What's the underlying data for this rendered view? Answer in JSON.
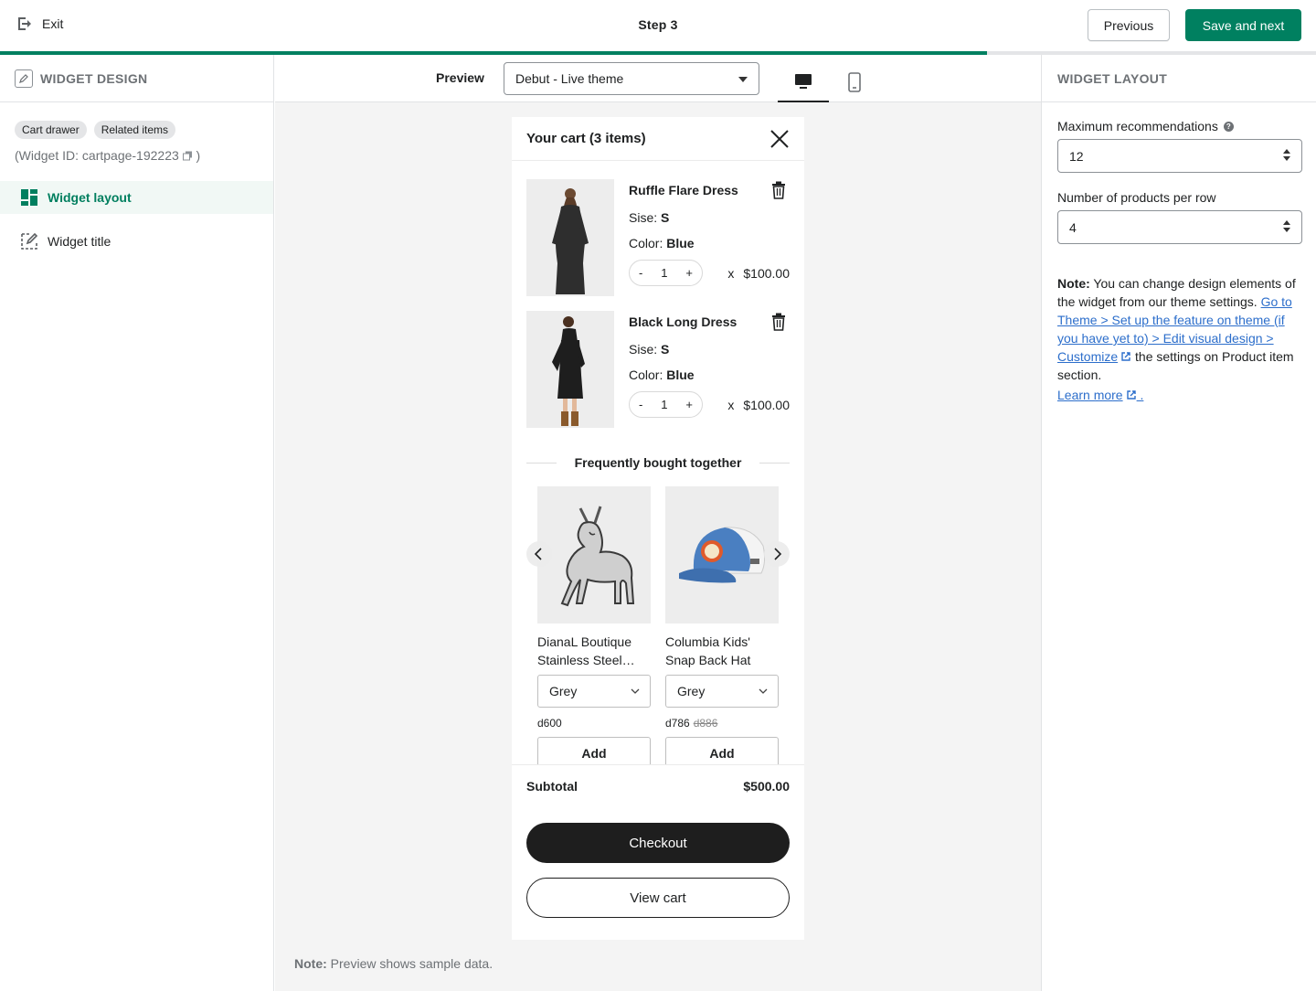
{
  "topbar": {
    "exit_label": "Exit",
    "step_label": "Step 3",
    "previous_label": "Previous",
    "save_next_label": "Save and next",
    "progress_fraction": 0.75
  },
  "left_panel": {
    "title": "WIDGET DESIGN",
    "tags": [
      "Cart drawer",
      "Related items"
    ],
    "widget_id_text": "(Widget ID: cartpage-192223",
    "widget_id_close": ")",
    "menu": [
      {
        "label": "Widget layout",
        "icon": "layout-icon",
        "active": true
      },
      {
        "label": "Widget title",
        "icon": "title-edit-icon",
        "active": false
      }
    ]
  },
  "preview": {
    "label": "Preview",
    "theme_selected": "Debut - Live theme",
    "devices": [
      "desktop-icon",
      "mobile-icon"
    ],
    "active_device": "desktop",
    "note_bold": "Note:",
    "note_text": " Preview shows sample data."
  },
  "cart": {
    "title": "Your cart (3 items)",
    "items": [
      {
        "name": "Ruffle Flare Dress",
        "size_label": "Sise: ",
        "size": "S",
        "color_label": "Color: ",
        "color": "Blue",
        "qty": "1",
        "x": "x",
        "price": "$100.00"
      },
      {
        "name": "Black Long Dress",
        "size_label": "Sise: ",
        "size": "S",
        "color_label": "Color: ",
        "color": "Blue",
        "qty": "1",
        "x": "x",
        "price": "$100.00"
      }
    ],
    "qty_minus": "-",
    "qty_plus": "+",
    "fbt_title": "Frequently bought together",
    "recommendations": [
      {
        "name": "DianaL Boutique Stainless Steel Silver Horse Pendant",
        "variant": "Grey",
        "price": "d600",
        "compare_price": "",
        "add_label": "Add"
      },
      {
        "name": "Columbia Kids' Snap Back Hat",
        "variant": "Grey",
        "price": "d786",
        "compare_price": "d886",
        "add_label": "Add"
      }
    ],
    "subtotal_label": "Subtotal",
    "subtotal_value": "$500.00",
    "checkout_label": "Checkout",
    "view_cart_label": "View cart"
  },
  "right_panel": {
    "title": "WIDGET LAYOUT",
    "max_rec_label": "Maximum recommendations",
    "max_rec_value": "12",
    "per_row_label": "Number of products per row",
    "per_row_value": "4",
    "note_bold": "Note:",
    "note_text": " You can change design elements of the widget from our theme settings. ",
    "note_link": "Go to Theme > Set up the feature on theme (if you have yet to) > Edit visual design > Customize",
    "note_tail": " the settings on Product item section.",
    "learn_more": "Learn more",
    "learn_more_dot": "."
  },
  "colors": {
    "primary": "#008060",
    "active_bg": "#f1f8f5",
    "link": "#2c6ecb",
    "checkout_bg": "#1e1e1e"
  }
}
